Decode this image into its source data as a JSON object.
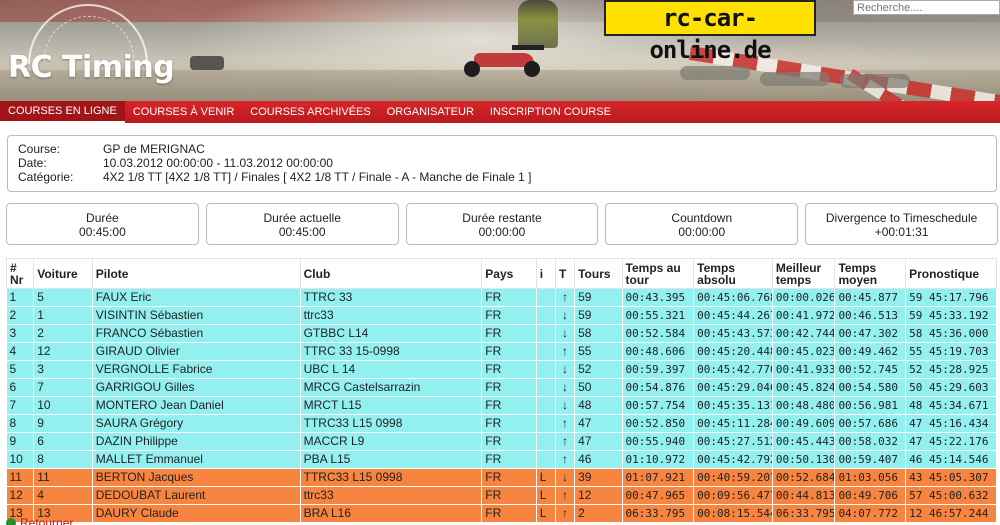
{
  "header": {
    "logo_text": "RC Timing",
    "sponsor_text": "rc-car-online.de",
    "search_placeholder": "Recherche...."
  },
  "nav": {
    "items": [
      {
        "label": "COURSES EN LIGNE",
        "active": true
      },
      {
        "label": "COURSES À VENIR",
        "active": false
      },
      {
        "label": "COURSES ARCHIVÉES",
        "active": false
      },
      {
        "label": "ORGANISATEUR",
        "active": false
      },
      {
        "label": "INSCRIPTION COURSE",
        "active": false
      }
    ]
  },
  "course": {
    "course_label": "Course:",
    "course_value": "GP de MERIGNAC",
    "date_label": "Date:",
    "date_value": "10.03.2012 00:00:00 - 11.03.2012 00:00:00",
    "category_label": "Catégorie:",
    "category_value": "4X2 1/8 TT [4X2 1/8 TT] / Finales [ 4X2 1/8 TT / Finale - A - Manche de Finale 1 ]"
  },
  "timers": [
    {
      "label": "Durée",
      "value": "00:45:00"
    },
    {
      "label": "Durée actuelle",
      "value": "00:45:00"
    },
    {
      "label": "Durée restante",
      "value": "00:00:00"
    },
    {
      "label": "Countdown",
      "value": "00:00:00"
    },
    {
      "label": "Divergence to Timeschedule",
      "value": "+00:01:31"
    }
  ],
  "table": {
    "headers": [
      "# Nr",
      "Voiture",
      "Pilote",
      "Club",
      "Pays",
      "i",
      "T",
      "Tours",
      "Temps au tour",
      "Temps absolu",
      "Meilleur temps",
      "Temps moyen",
      "Pronostique"
    ],
    "rows": [
      {
        "pos": "1",
        "car": "5",
        "pilot": "FAUX Eric",
        "club": "TTRC 33",
        "country": "FR",
        "i": "",
        "trend": "up",
        "laps": "59",
        "lap_time": "00:43.395",
        "abs_time": "00:45:06.768",
        "best": "00:00.026",
        "avg": "00:45.877",
        "prog": "59 45:17.796",
        "color": "cyan"
      },
      {
        "pos": "2",
        "car": "1",
        "pilot": "VISINTIN Sébastien",
        "club": "ttrc33",
        "country": "FR",
        "i": "",
        "trend": "down",
        "laps": "59",
        "lap_time": "00:55.321",
        "abs_time": "00:45:44.267",
        "best": "00:41.972",
        "avg": "00:46.513",
        "prog": "59 45:33.192",
        "color": "cyan"
      },
      {
        "pos": "3",
        "car": "2",
        "pilot": "FRANCO Sébastien",
        "club": "GTBBC L14",
        "country": "FR",
        "i": "",
        "trend": "down",
        "laps": "58",
        "lap_time": "00:52.584",
        "abs_time": "00:45:43.573",
        "best": "00:42.744",
        "avg": "00:47.302",
        "prog": "58 45:36.000",
        "color": "cyan"
      },
      {
        "pos": "4",
        "car": "12",
        "pilot": "GIRAUD Olivier",
        "club": "TTRC 33 15-0998",
        "country": "FR",
        "i": "",
        "trend": "up",
        "laps": "55",
        "lap_time": "00:48.606",
        "abs_time": "00:45:20.448",
        "best": "00:45.023",
        "avg": "00:49.462",
        "prog": "55 45:19.703",
        "color": "cyan"
      },
      {
        "pos": "5",
        "car": "3",
        "pilot": "VERGNOLLE Fabrice",
        "club": "UBC L 14",
        "country": "FR",
        "i": "",
        "trend": "down",
        "laps": "52",
        "lap_time": "00:59.397",
        "abs_time": "00:45:42.770",
        "best": "00:41.933",
        "avg": "00:52.745",
        "prog": "52 45:28.925",
        "color": "cyan"
      },
      {
        "pos": "6",
        "car": "7",
        "pilot": "GARRIGOU Gilles",
        "club": "MRCG Castelsarrazin",
        "country": "FR",
        "i": "",
        "trend": "down",
        "laps": "50",
        "lap_time": "00:54.876",
        "abs_time": "00:45:29.046",
        "best": "00:45.824",
        "avg": "00:54.580",
        "prog": "50 45:29.603",
        "color": "cyan"
      },
      {
        "pos": "7",
        "car": "10",
        "pilot": "MONTERO Jean Daniel",
        "club": "MRCT L15",
        "country": "FR",
        "i": "",
        "trend": "down",
        "laps": "48",
        "lap_time": "00:57.754",
        "abs_time": "00:45:35.131",
        "best": "00:48.480",
        "avg": "00:56.981",
        "prog": "48 45:34.671",
        "color": "cyan"
      },
      {
        "pos": "8",
        "car": "9",
        "pilot": "SAURA Grégory",
        "club": "TTRC33 L15 0998",
        "country": "FR",
        "i": "",
        "trend": "up",
        "laps": "47",
        "lap_time": "00:52.850",
        "abs_time": "00:45:11.284",
        "best": "00:49.609",
        "avg": "00:57.686",
        "prog": "47 45:16.434",
        "color": "cyan"
      },
      {
        "pos": "9",
        "car": "6",
        "pilot": "DAZIN Philippe",
        "club": "MACCR L9",
        "country": "FR",
        "i": "",
        "trend": "up",
        "laps": "47",
        "lap_time": "00:55.940",
        "abs_time": "00:45:27.512",
        "best": "00:45.443",
        "avg": "00:58.032",
        "prog": "47 45:22.176",
        "color": "cyan"
      },
      {
        "pos": "10",
        "car": "8",
        "pilot": "MALLET Emmanuel",
        "club": "PBA L15",
        "country": "FR",
        "i": "",
        "trend": "up",
        "laps": "46",
        "lap_time": "01:10.972",
        "abs_time": "00:45:42.792",
        "best": "00:50.130",
        "avg": "00:59.407",
        "prog": "46 45:14.546",
        "color": "cyan"
      },
      {
        "pos": "11",
        "car": "11",
        "pilot": "BERTON Jacques",
        "club": "TTRC33 L15 0998",
        "country": "FR",
        "i": "L",
        "trend": "down",
        "laps": "39",
        "lap_time": "01:07.921",
        "abs_time": "00:40:59.207",
        "best": "00:52.684",
        "avg": "01:03.056",
        "prog": "43 45:05.307",
        "color": "orange"
      },
      {
        "pos": "12",
        "car": "4",
        "pilot": "DEDOUBAT Laurent",
        "club": "ttrc33",
        "country": "FR",
        "i": "L",
        "trend": "up",
        "laps": "12",
        "lap_time": "00:47.965",
        "abs_time": "00:09:56.477",
        "best": "00:44.813",
        "avg": "00:49.706",
        "prog": "57 45:00.632",
        "color": "orange"
      },
      {
        "pos": "13",
        "car": "13",
        "pilot": "DAURY Claude",
        "club": "BRA L16",
        "country": "FR",
        "i": "L",
        "trend": "up",
        "laps": "2",
        "lap_time": "06:33.795",
        "abs_time": "00:08:15.544",
        "best": "06:33.795",
        "avg": "04:07.772",
        "prog": "12 46:57.244",
        "color": "orange"
      }
    ]
  },
  "footer": {
    "back_label": "Retourner"
  },
  "colors": {
    "nav_red": "#d8262a",
    "row_running": "#93f0f0",
    "row_stopped": "#f7853f",
    "sponsor_yellow": "#ffe000"
  }
}
